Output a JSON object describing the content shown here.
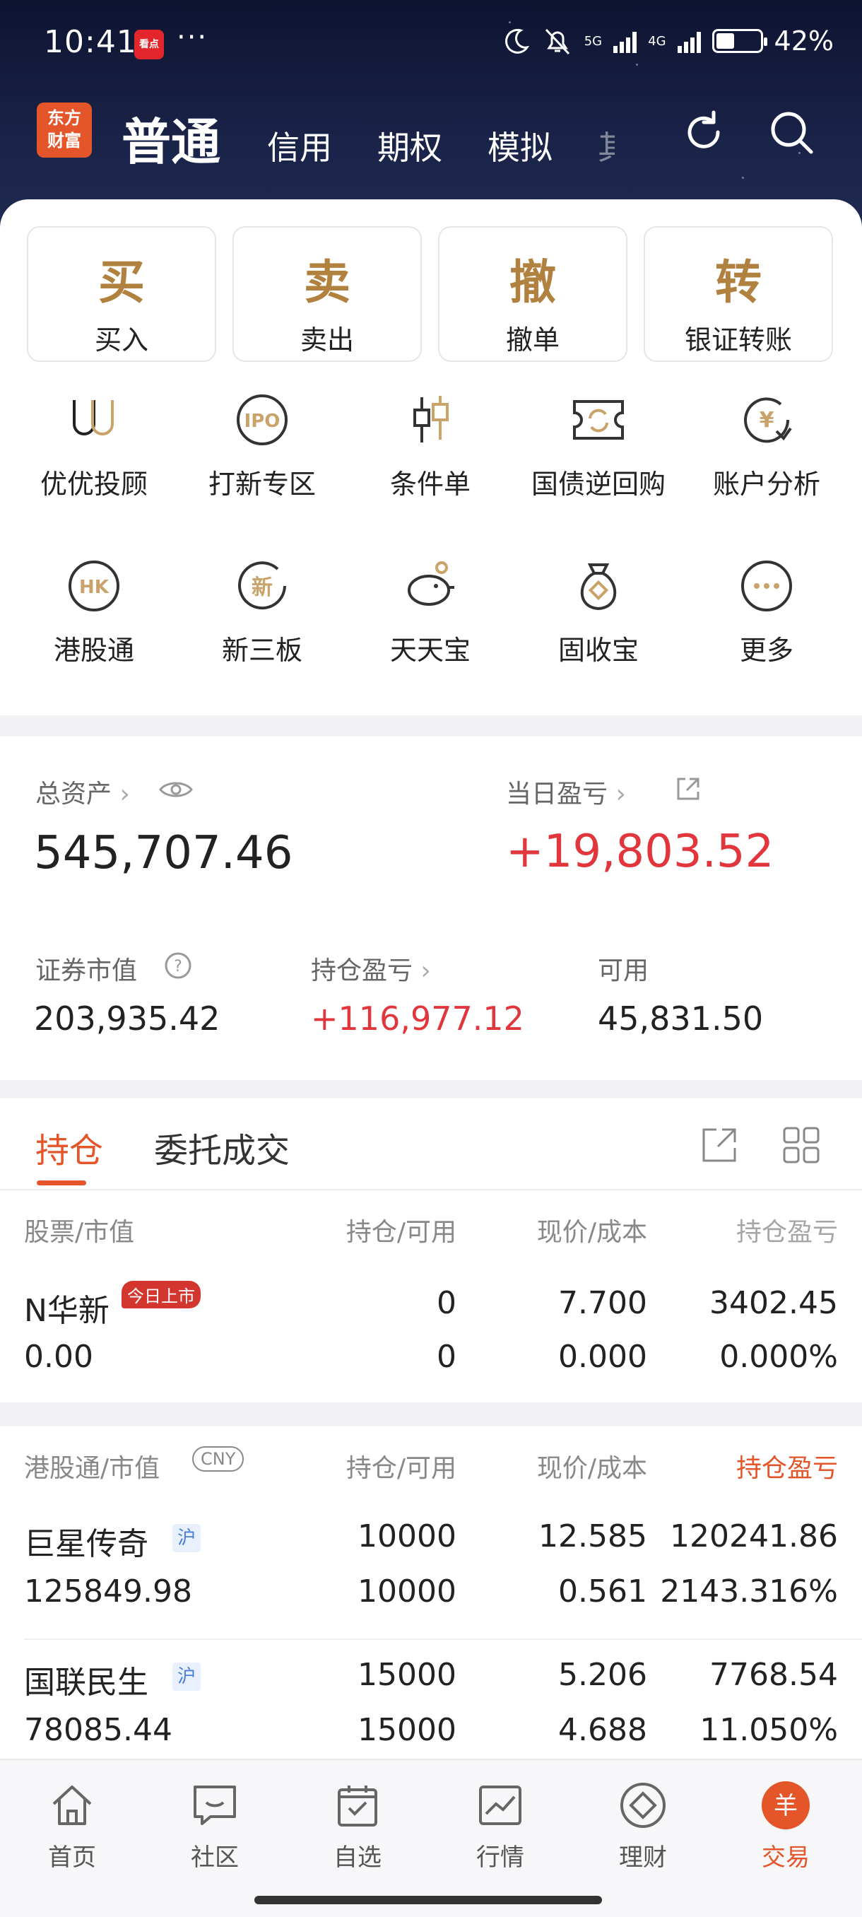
{
  "status_bar": {
    "time": "10:41",
    "app_badge": "看点",
    "more": "···",
    "net1": "5G",
    "net2": "4G",
    "battery": "42%",
    "battery_level": 0.42
  },
  "header": {
    "logo": [
      "东方",
      "财富"
    ],
    "tabs": [
      "普通",
      "信用",
      "期权",
      "模拟",
      "其"
    ]
  },
  "actions": [
    {
      "char": "买",
      "label": "买入"
    },
    {
      "char": "卖",
      "label": "卖出"
    },
    {
      "char": "撤",
      "label": "撤单"
    },
    {
      "char": "转",
      "label": "银证转账"
    }
  ],
  "grid": [
    {
      "label": "优优投顾",
      "icon": "uu-advisor-icon"
    },
    {
      "label": "打新专区",
      "icon": "ipo-icon"
    },
    {
      "label": "条件单",
      "icon": "candlestick-icon"
    },
    {
      "label": "国债逆回购",
      "icon": "bond-repo-icon"
    },
    {
      "label": "账户分析",
      "icon": "yen-chart-icon"
    },
    {
      "label": "港股通",
      "icon": "hk-icon"
    },
    {
      "label": "新三板",
      "icon": "new-board-icon"
    },
    {
      "label": "天天宝",
      "icon": "piggy-bank-icon"
    },
    {
      "label": "固收宝",
      "icon": "money-bag-icon"
    },
    {
      "label": "更多",
      "icon": "more-icon"
    }
  ],
  "grid_icon_text": {
    "ipo": "IPO",
    "hk": "HK",
    "xin": "新",
    "yen": "¥"
  },
  "assets": {
    "total_label": "总资产",
    "total_value": "545,707.46",
    "daily_label": "当日盈亏",
    "daily_value": "+19,803.52",
    "market_label": "证券市值",
    "market_value": "203,935.42",
    "holding_pl_label": "持仓盈亏",
    "holding_pl_value": "+116,977.12",
    "available_label": "可用",
    "available_value": "45,831.50"
  },
  "positions": {
    "tabs": [
      "持仓",
      "委托成交"
    ],
    "headers": [
      "股票/市值",
      "持仓/可用",
      "现价/成本",
      "持仓盈亏"
    ],
    "rows": [
      {
        "name": "N华新",
        "badge": "今日上市",
        "value": "0.00",
        "hold": "0",
        "avail": "0",
        "price": "7.700",
        "cost": "0.000",
        "pl": "3402.45",
        "pl_pct": "0.000%"
      }
    ]
  },
  "hk_positions": {
    "headers": [
      "港股通/市值",
      "持仓/可用",
      "现价/成本",
      "持仓盈亏"
    ],
    "currency": "CNY",
    "rows": [
      {
        "name": "巨星传奇",
        "badge": "沪",
        "value": "125849.98",
        "hold": "10000",
        "avail": "10000",
        "price": "12.585",
        "cost": "0.561",
        "pl": "120241.86",
        "pl_pct": "2143.316%"
      },
      {
        "name": "国联民生",
        "badge": "沪",
        "value": "78085.44",
        "hold": "15000",
        "avail": "15000",
        "price": "5.206",
        "cost": "4.688",
        "pl": "7768.54",
        "pl_pct": "11.050%"
      }
    ]
  },
  "bottom_nav": [
    {
      "label": "首页",
      "icon": "home-icon"
    },
    {
      "label": "社区",
      "icon": "community-icon"
    },
    {
      "label": "自选",
      "icon": "watchlist-icon"
    },
    {
      "label": "行情",
      "icon": "market-icon"
    },
    {
      "label": "理财",
      "icon": "finance-icon"
    },
    {
      "label": "交易",
      "icon": "trade-icon"
    }
  ],
  "trade_icon_glyph": "羊",
  "colors": {
    "accent": "#e4552a",
    "gold": "#b0813f",
    "red": "#e0363c"
  }
}
